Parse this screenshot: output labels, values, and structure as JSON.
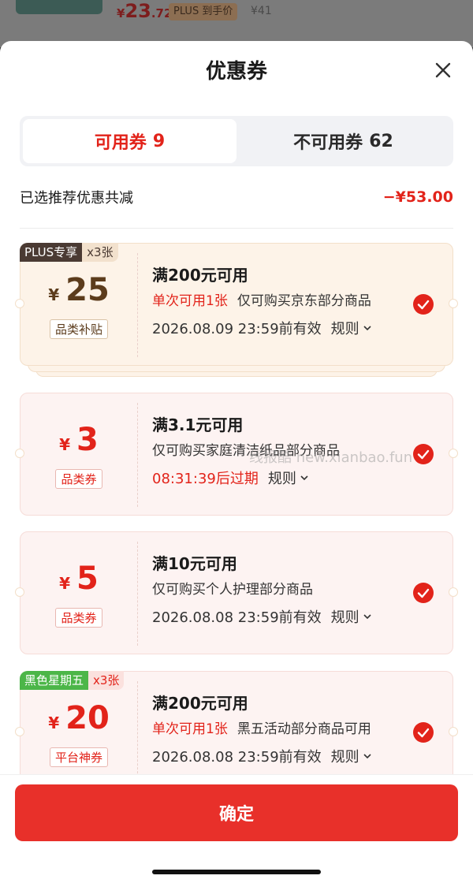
{
  "background": {
    "price_symbol": "¥",
    "price_int": "23",
    "price_dec": ".72",
    "plus_label": "PLUS 到手价",
    "original_price": "¥41"
  },
  "sheet": {
    "title": "优惠券",
    "close_icon": "close-icon"
  },
  "tabs": [
    {
      "label": "可用券",
      "count": "9",
      "active": true
    },
    {
      "label": "不可用券",
      "count": "62",
      "active": false
    }
  ],
  "summary": {
    "label": "已选推荐优惠共减",
    "value": "−¥53.00"
  },
  "coupons": [
    {
      "tag": "PLUS专享",
      "tag_count": "x3张",
      "yen": "¥",
      "amount": "25",
      "category": "品类补贴",
      "condition": "满200元可用",
      "limit": "单次可用1张",
      "scope": "仅可购买京东部分商品",
      "validity": "2026.08.09 23:59前有效",
      "rule": "规则",
      "checked": true
    },
    {
      "yen": "¥",
      "amount": "3",
      "category": "品类券",
      "condition": "满3.1元可用",
      "scope": "仅可购买家庭清洁纸品部分商品",
      "countdown": "08:31:39后过期",
      "rule": "规则",
      "checked": true
    },
    {
      "yen": "¥",
      "amount": "5",
      "category": "品类券",
      "condition": "满10元可用",
      "scope": "仅可购买个人护理部分商品",
      "validity": "2026.08.08 23:59前有效",
      "rule": "规则",
      "checked": true
    },
    {
      "tag": "黑色星期五",
      "tag_count": "x3张",
      "yen": "¥",
      "amount": "20",
      "category": "平台神券",
      "condition": "满200元可用",
      "limit": "单次可用1张",
      "scope": "黑五活动部分商品可用",
      "validity": "2026.08.08 23:59前有效",
      "rule": "规则",
      "checked": true
    }
  ],
  "watermark": "线报酷 new.xianbao.fun",
  "footer": {
    "confirm_label": "确定"
  },
  "colors": {
    "accent": "#e2231a",
    "plus_brown": "#5c3c1c",
    "black_friday_green": "#4cb648"
  }
}
